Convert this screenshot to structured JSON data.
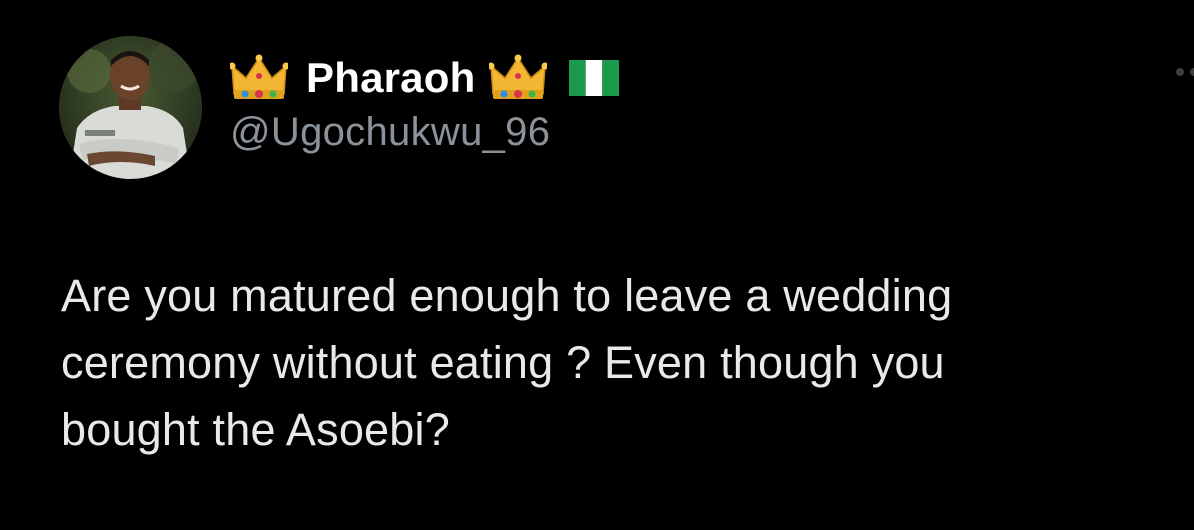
{
  "tweet": {
    "display_name": "Pharaoh",
    "handle": "@Ugochukwu_96",
    "name_emojis": [
      "crown-emoji",
      "crown-emoji",
      "nigeria-flag-emoji"
    ],
    "text": "Are you matured enough to leave a wedding\nceremony without eating ? Even though you\nbought the Asoebi?"
  },
  "colors": {
    "background": "#000000",
    "display_name": "#ffffff",
    "handle": "#8b9299",
    "body_text": "#e7e9ea"
  }
}
